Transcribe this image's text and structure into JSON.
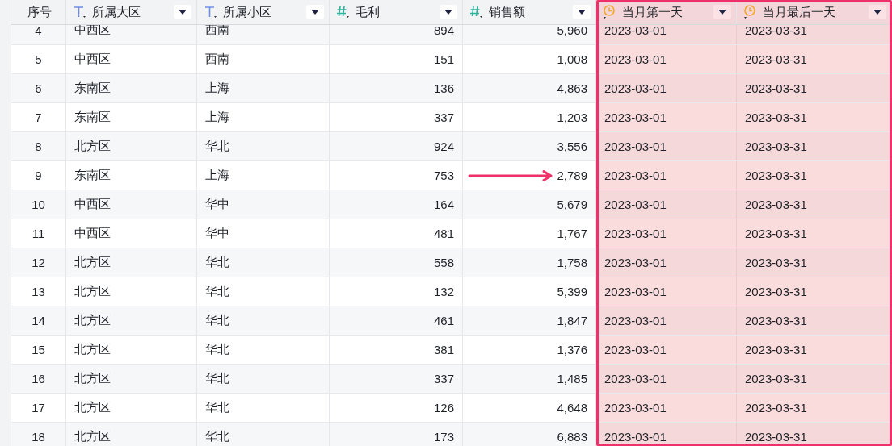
{
  "table": {
    "columns": [
      {
        "label": "序号",
        "kind": "index",
        "highlighted": false
      },
      {
        "label": "所属大区",
        "kind": "text",
        "highlighted": false
      },
      {
        "label": "所属小区",
        "kind": "text",
        "highlighted": false
      },
      {
        "label": "毛利",
        "kind": "number",
        "highlighted": false
      },
      {
        "label": "销售额",
        "kind": "number",
        "highlighted": false
      },
      {
        "label": "当月第一天",
        "kind": "date",
        "highlighted": true
      },
      {
        "label": "当月最后一天",
        "kind": "date",
        "highlighted": true
      }
    ],
    "rows": [
      {
        "cells": [
          "4",
          "中西区",
          "西南",
          "894",
          "5,960",
          "2023-03-01",
          "2023-03-31"
        ],
        "arrow": false
      },
      {
        "cells": [
          "5",
          "中西区",
          "西南",
          "151",
          "1,008",
          "2023-03-01",
          "2023-03-31"
        ],
        "arrow": false
      },
      {
        "cells": [
          "6",
          "东南区",
          "上海",
          "136",
          "4,863",
          "2023-03-01",
          "2023-03-31"
        ],
        "arrow": false
      },
      {
        "cells": [
          "7",
          "东南区",
          "上海",
          "337",
          "1,203",
          "2023-03-01",
          "2023-03-31"
        ],
        "arrow": false
      },
      {
        "cells": [
          "8",
          "北方区",
          "华北",
          "924",
          "3,556",
          "2023-03-01",
          "2023-03-31"
        ],
        "arrow": false
      },
      {
        "cells": [
          "9",
          "东南区",
          "上海",
          "753",
          "2,789",
          "2023-03-01",
          "2023-03-31"
        ],
        "arrow": true
      },
      {
        "cells": [
          "10",
          "中西区",
          "华中",
          "164",
          "5,679",
          "2023-03-01",
          "2023-03-31"
        ],
        "arrow": false
      },
      {
        "cells": [
          "11",
          "中西区",
          "华中",
          "481",
          "1,767",
          "2023-03-01",
          "2023-03-31"
        ],
        "arrow": false
      },
      {
        "cells": [
          "12",
          "北方区",
          "华北",
          "558",
          "1,758",
          "2023-03-01",
          "2023-03-31"
        ],
        "arrow": false
      },
      {
        "cells": [
          "13",
          "北方区",
          "华北",
          "132",
          "5,399",
          "2023-03-01",
          "2023-03-31"
        ],
        "arrow": false
      },
      {
        "cells": [
          "14",
          "北方区",
          "华北",
          "461",
          "1,847",
          "2023-03-01",
          "2023-03-31"
        ],
        "arrow": false
      },
      {
        "cells": [
          "15",
          "北方区",
          "华北",
          "381",
          "1,376",
          "2023-03-01",
          "2023-03-31"
        ],
        "arrow": false
      },
      {
        "cells": [
          "16",
          "北方区",
          "华北",
          "337",
          "1,485",
          "2023-03-01",
          "2023-03-31"
        ],
        "arrow": false
      },
      {
        "cells": [
          "17",
          "北方区",
          "华北",
          "126",
          "4,648",
          "2023-03-01",
          "2023-03-31"
        ],
        "arrow": false
      },
      {
        "cells": [
          "18",
          "北方区",
          "华北",
          "173",
          "6,883",
          "2023-03-01",
          "2023-03-31"
        ],
        "arrow": false
      }
    ]
  }
}
